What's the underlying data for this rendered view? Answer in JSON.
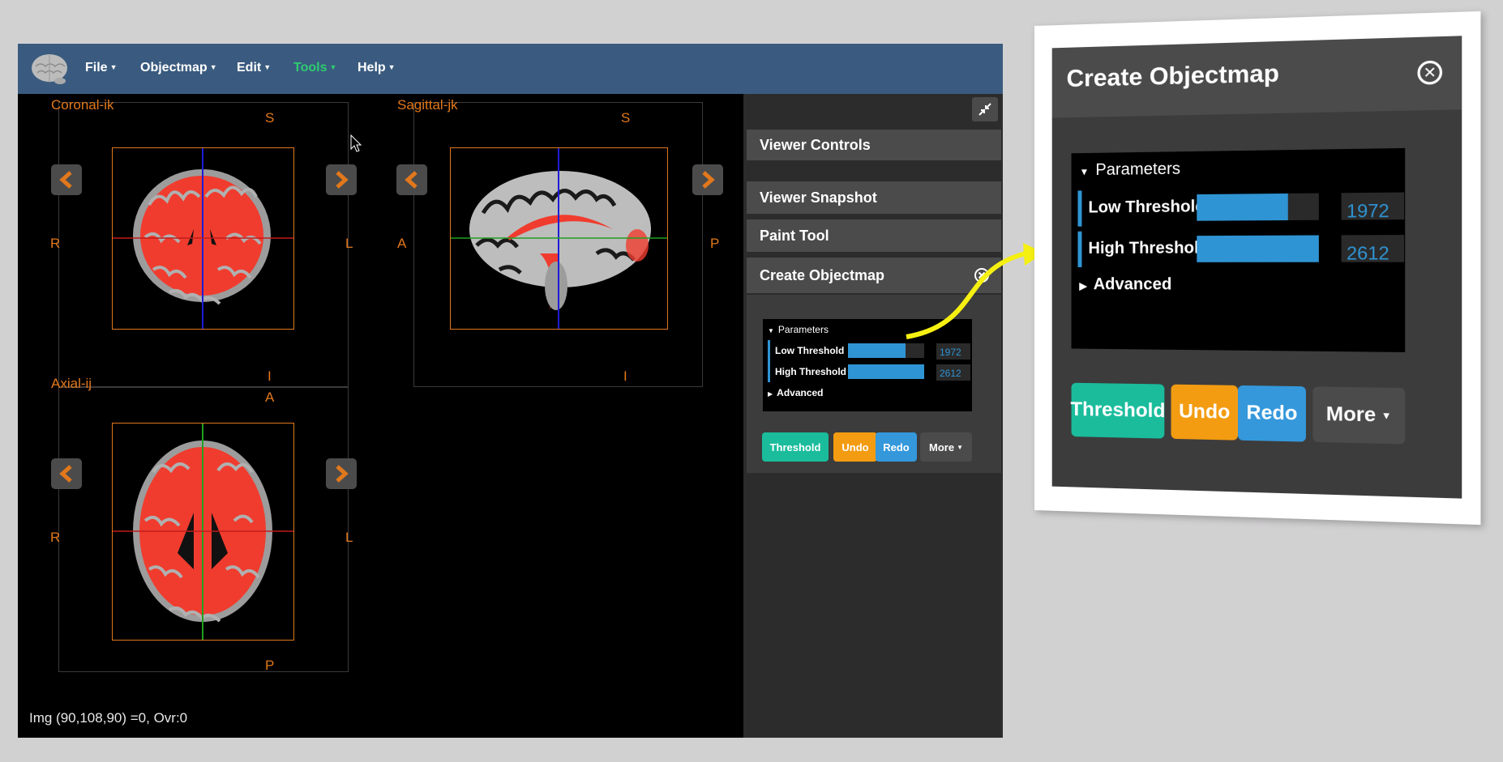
{
  "navbar": {
    "menus": [
      "File",
      "Objectmap",
      "Edit",
      "Tools",
      "Help"
    ],
    "active_menu": "Tools"
  },
  "viewer": {
    "coronal": {
      "title": "Coronal-ik",
      "top": "S",
      "bottom": "I",
      "left": "R",
      "right": "L"
    },
    "sagittal": {
      "title": "Sagittal-jk",
      "top": "S",
      "bottom": "I",
      "left": "A",
      "right": "P"
    },
    "axial": {
      "title": "Axial-ij",
      "top": "A",
      "bottom": "P",
      "left": "R",
      "right": "L"
    },
    "status": "Img (90,108,90) =0, Ovr:0"
  },
  "sidebar": {
    "panels": [
      "Viewer Controls",
      "Viewer Snapshot",
      "Paint Tool",
      "Create Objectmap"
    ],
    "params": {
      "folder": "Parameters",
      "low_label": "Low Threshold",
      "low_value": "1972",
      "low_fill": 0.75,
      "high_label": "High Threshold",
      "high_value": "2612",
      "high_fill": 1.0,
      "advanced": "Advanced"
    },
    "buttons": {
      "threshold": "Threshold",
      "undo": "Undo",
      "redo": "Redo",
      "more": "More"
    }
  },
  "zoom": {
    "title": "Create Objectmap",
    "close_icon": "close-circle-icon"
  },
  "colors": {
    "navbar": "#3a5b7f",
    "orange": "#e1781c",
    "slider_blue": "#2f94d3",
    "threshold_green": "#1abc9c",
    "undo_orange": "#f39c12",
    "redo_blue": "#3498db",
    "more_gray": "#4b4b4b"
  }
}
